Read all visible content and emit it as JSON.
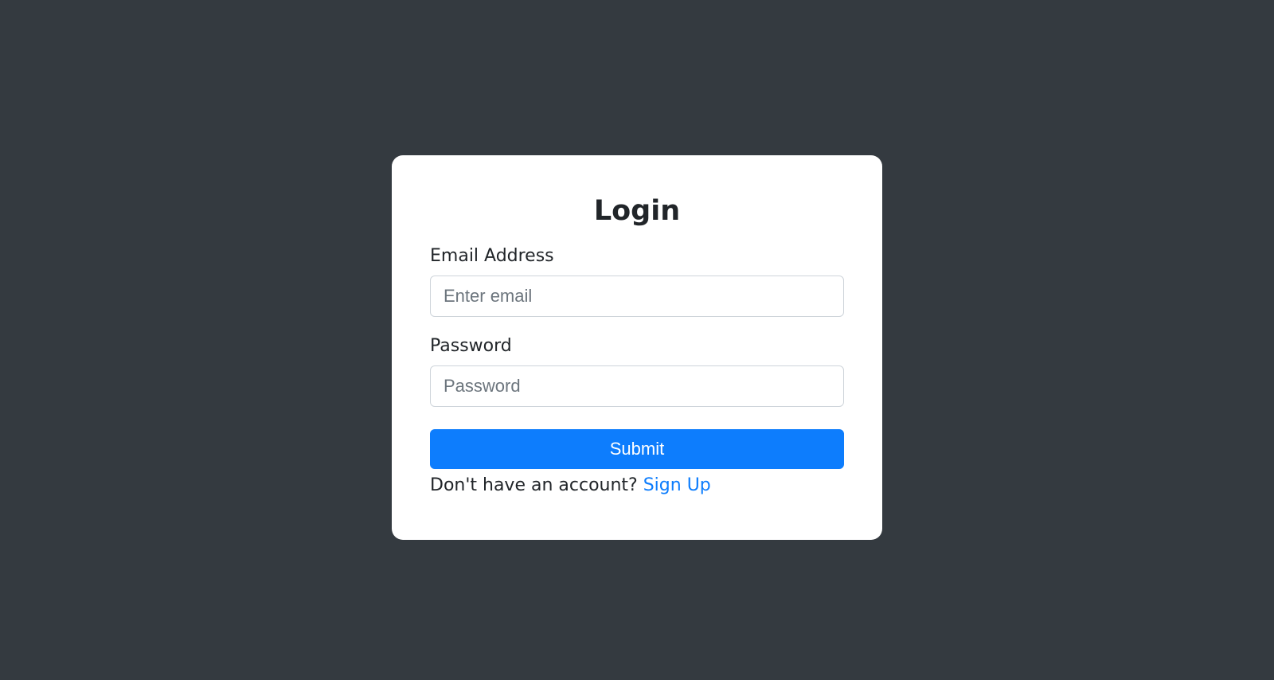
{
  "login": {
    "title": "Login",
    "email": {
      "label": "Email Address",
      "placeholder": "Enter email",
      "value": ""
    },
    "password": {
      "label": "Password",
      "placeholder": "Password",
      "value": ""
    },
    "submit_label": "Submit",
    "signup_prompt": "Don't have an account? ",
    "signup_link": "Sign Up"
  }
}
